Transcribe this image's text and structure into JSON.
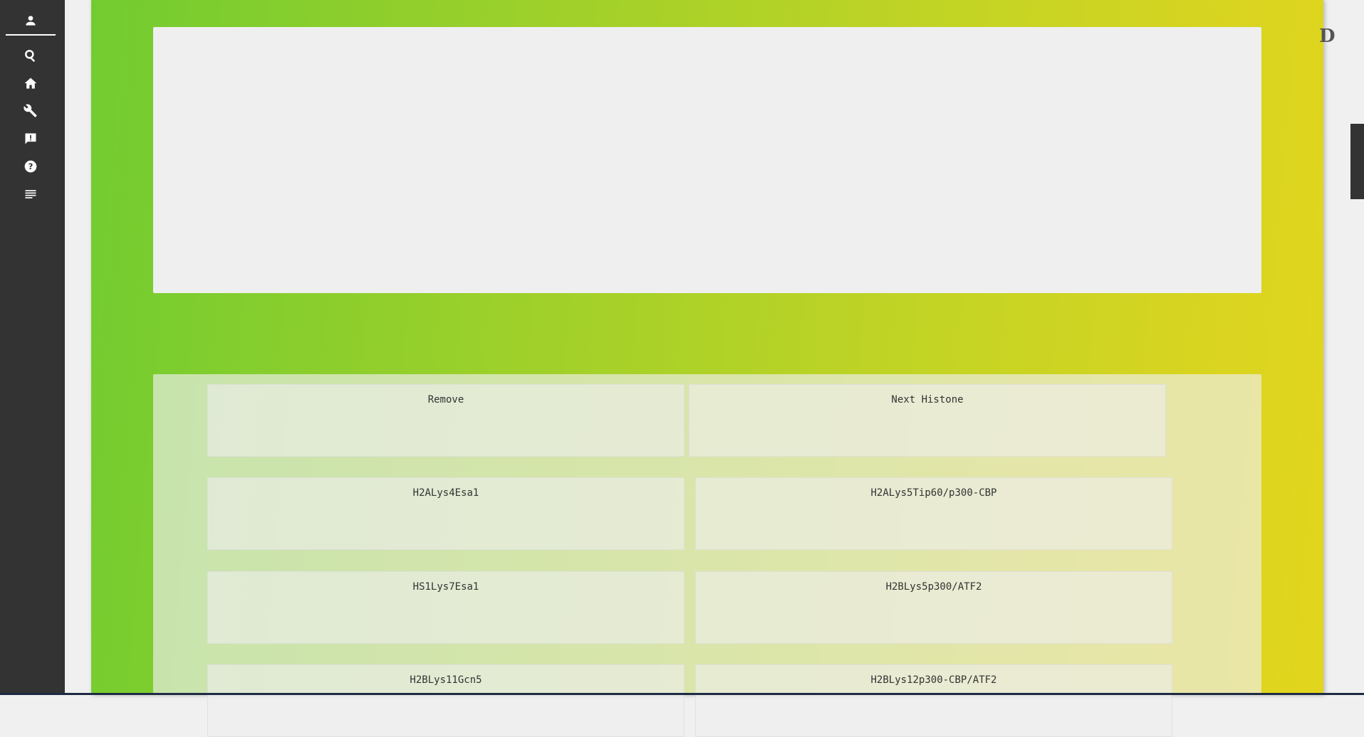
{
  "sidebar": {
    "icons": [
      "person-icon",
      "search-icon",
      "home-icon",
      "wrench-icon",
      "feedback-icon",
      "help-icon",
      "notes-icon"
    ]
  },
  "panel": {
    "gradient_start": "#72cc30",
    "gradient_end": "#e3d51e"
  },
  "top_buttons": [
    "Remove",
    "Next Histone"
  ],
  "enzyme_buttons": [
    [
      "H2ALys4Esa1",
      "H2ALys5Tip60/p300-CBP"
    ],
    [
      "HS1Lys7Esa1",
      "H2BLys5p300/ATF2"
    ],
    [
      "H2BLys11Gcn5",
      "H2BLys12p300-CBP/ATF2"
    ]
  ],
  "right_edge_glyph": "D"
}
